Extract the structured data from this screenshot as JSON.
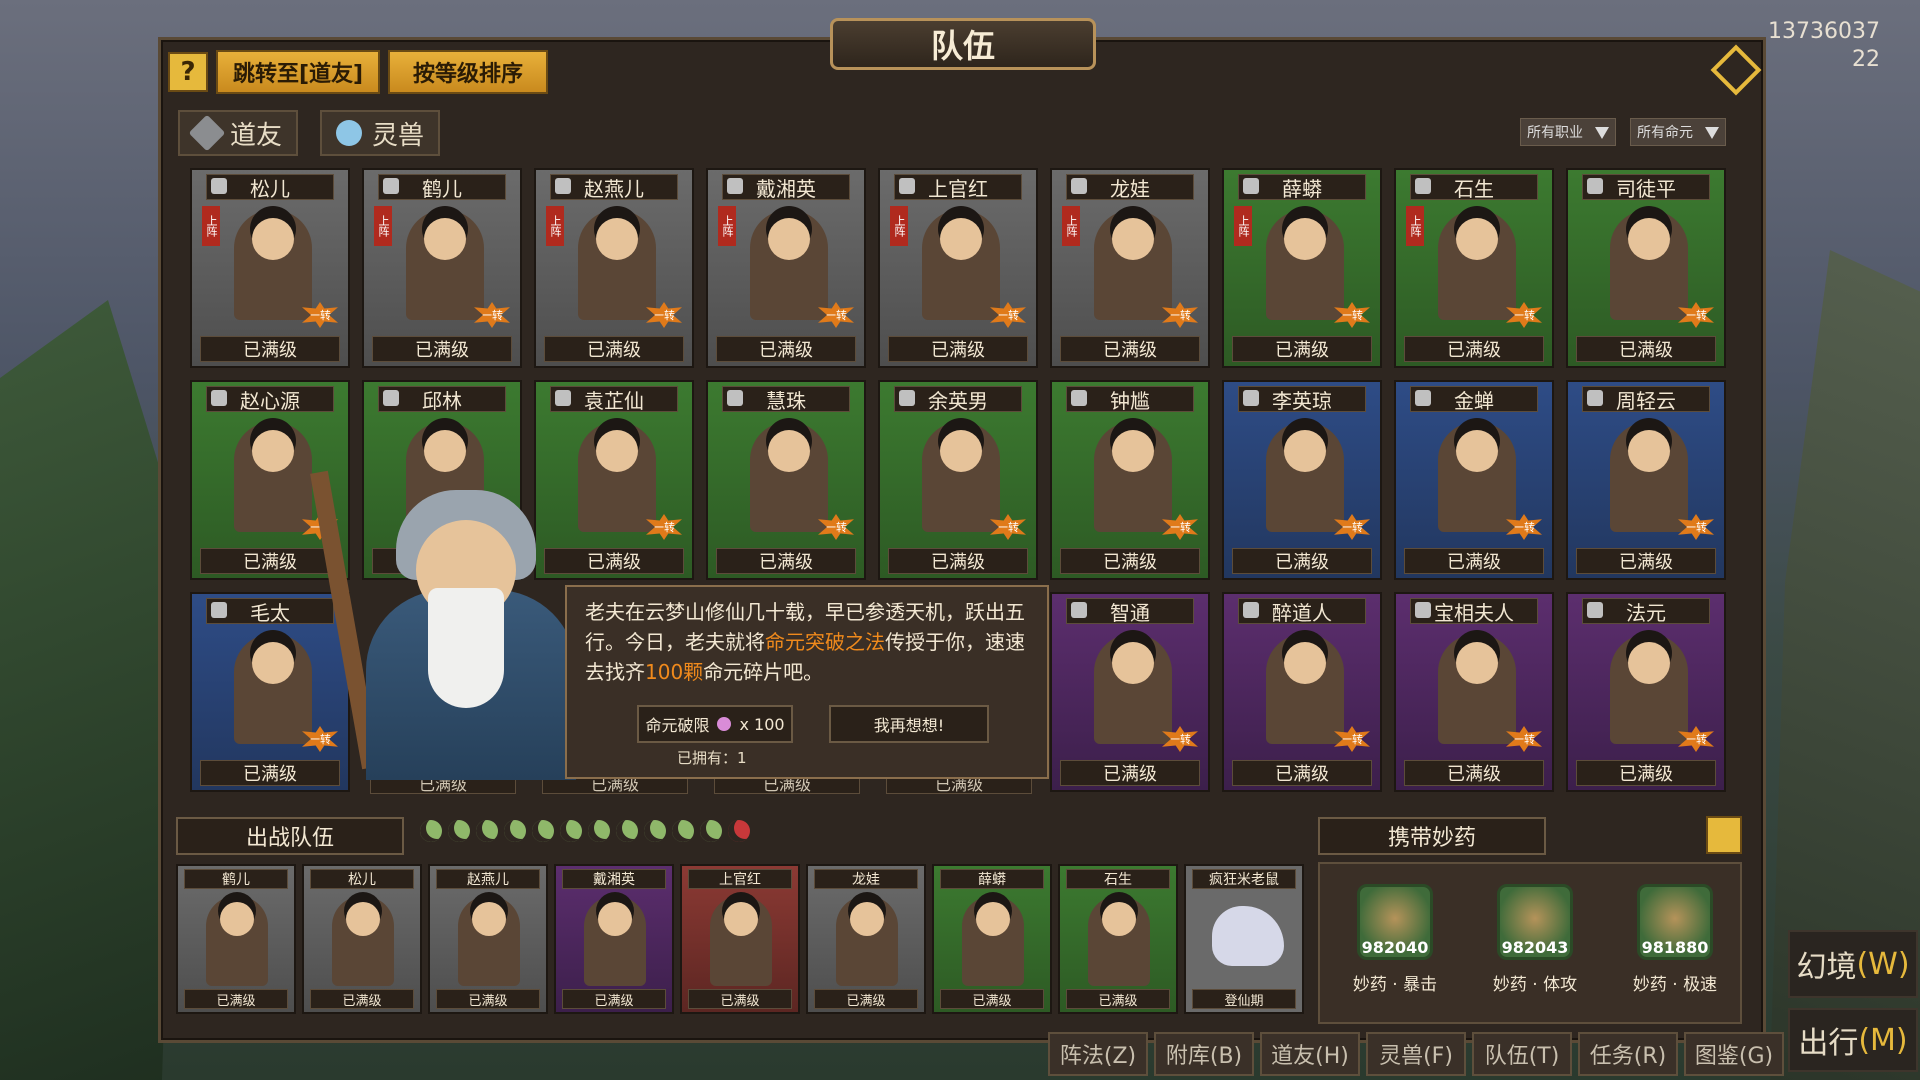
{
  "title": "队伍",
  "stats": {
    "currency": "13736037",
    "count": "22"
  },
  "top_buttons": {
    "help": "?",
    "jump": "跳转至[道友]",
    "sort": "按等级排序"
  },
  "tabs": [
    {
      "label": "道友"
    },
    {
      "label": "灵兽"
    }
  ],
  "filters": {
    "job": "所有职业",
    "fate": "所有命元"
  },
  "row1": [
    {
      "name": "松儿",
      "level": "已满级",
      "badge": "一转",
      "tag": "上阵",
      "color": "g-grey"
    },
    {
      "name": "鹤儿",
      "level": "已满级",
      "badge": "一转",
      "tag": "上阵",
      "color": "g-grey"
    },
    {
      "name": "赵燕儿",
      "level": "已满级",
      "badge": "一转",
      "tag": "上阵",
      "color": "g-grey"
    },
    {
      "name": "戴湘英",
      "level": "已满级",
      "badge": "一转",
      "tag": "上阵",
      "color": "g-grey"
    },
    {
      "name": "上官红",
      "level": "已满级",
      "badge": "一转",
      "tag": "上阵",
      "color": "g-grey"
    },
    {
      "name": "龙娃",
      "level": "已满级",
      "badge": "一转",
      "tag": "上阵",
      "color": "g-grey"
    },
    {
      "name": "薛蟒",
      "level": "已满级",
      "badge": "一转",
      "tag": "上阵",
      "color": "g-green"
    },
    {
      "name": "石生",
      "level": "已满级",
      "badge": "一转",
      "tag": "上阵",
      "color": "g-green"
    },
    {
      "name": "司徒平",
      "level": "已满级",
      "badge": "一转",
      "tag": "",
      "color": "g-green"
    }
  ],
  "row2": [
    {
      "name": "赵心源",
      "level": "已满级",
      "badge": "一转",
      "color": "g-green"
    },
    {
      "name": "邱林",
      "level": "已满级",
      "badge": "一转",
      "color": "g-green"
    },
    {
      "name": "袁芷仙",
      "level": "已满级",
      "badge": "一转",
      "color": "g-green"
    },
    {
      "name": "慧珠",
      "level": "已满级",
      "badge": "一转",
      "color": "g-green"
    },
    {
      "name": "余英男",
      "level": "已满级",
      "badge": "一转",
      "color": "g-green"
    },
    {
      "name": "钟尴",
      "level": "已满级",
      "badge": "一转",
      "color": "g-green"
    },
    {
      "name": "李英琼",
      "level": "已满级",
      "badge": "一转",
      "color": "g-blue"
    },
    {
      "name": "金蝉",
      "level": "已满级",
      "badge": "一转",
      "color": "g-blue"
    },
    {
      "name": "周轻云",
      "level": "已满级",
      "badge": "一转",
      "color": "g-blue"
    }
  ],
  "row3": [
    {
      "name": "毛太",
      "level": "已满级",
      "badge": "一转",
      "color": "g-blue"
    },
    {
      "name": "智通",
      "level": "已满级",
      "badge": "一转",
      "color": "g-purple"
    },
    {
      "name": "醉道人",
      "level": "已满级",
      "badge": "一转",
      "color": "g-purple"
    },
    {
      "name": "宝相夫人",
      "level": "已满级",
      "badge": "一转",
      "color": "g-purple"
    },
    {
      "name": "法元",
      "level": "已满级",
      "badge": "一转",
      "color": "g-purple"
    }
  ],
  "hidden_levels": [
    "已满级",
    "已满级",
    "已满级",
    "已满级"
  ],
  "dialog": {
    "line_a": "老夫在云梦山修仙几十载，早已参透天机，跃出五行。今日，老夫就将",
    "highlight1": "命元突破之法",
    "line_b": "传授于你，速速去找齐",
    "highlight2": "100颗",
    "line_c": "命元碎片吧。",
    "confirm_label": "命元破限",
    "confirm_cost": "x 100",
    "cancel_label": "我再想想!",
    "owned": "已拥有：1"
  },
  "team": {
    "label": "出战队伍",
    "moons_total": 12,
    "members": [
      {
        "name": "鹤儿",
        "level": "已满级",
        "color": "g-grey"
      },
      {
        "name": "松儿",
        "level": "已满级",
        "color": "g-grey"
      },
      {
        "name": "赵燕儿",
        "level": "已满级",
        "color": "g-grey"
      },
      {
        "name": "戴湘英",
        "level": "已满级",
        "color": "g-purple"
      },
      {
        "name": "上官红",
        "level": "已满级",
        "color": "g-red"
      },
      {
        "name": "龙娃",
        "level": "已满级",
        "color": "g-grey"
      },
      {
        "name": "薛蟒",
        "level": "已满级",
        "color": "g-green"
      },
      {
        "name": "石生",
        "level": "已满级",
        "color": "g-green"
      }
    ],
    "pet": {
      "name": "疯狂米老鼠",
      "level": "登仙期"
    }
  },
  "potions": {
    "label": "携带妙药",
    "items": [
      {
        "count": "982040",
        "name": "妙药 · 暴击"
      },
      {
        "count": "982043",
        "name": "妙药 · 体攻"
      },
      {
        "count": "981880",
        "name": "妙药 · 极速"
      }
    ]
  },
  "bottom_tabs": [
    "阵法(Z)",
    "附库(B)",
    "道友(H)",
    "灵兽(F)",
    "队伍(T)",
    "任务(R)",
    "图鉴(G)"
  ],
  "side_buttons": [
    {
      "label": "幻境",
      "key": "(W)"
    },
    {
      "label": "出行",
      "key": "(M)"
    }
  ]
}
